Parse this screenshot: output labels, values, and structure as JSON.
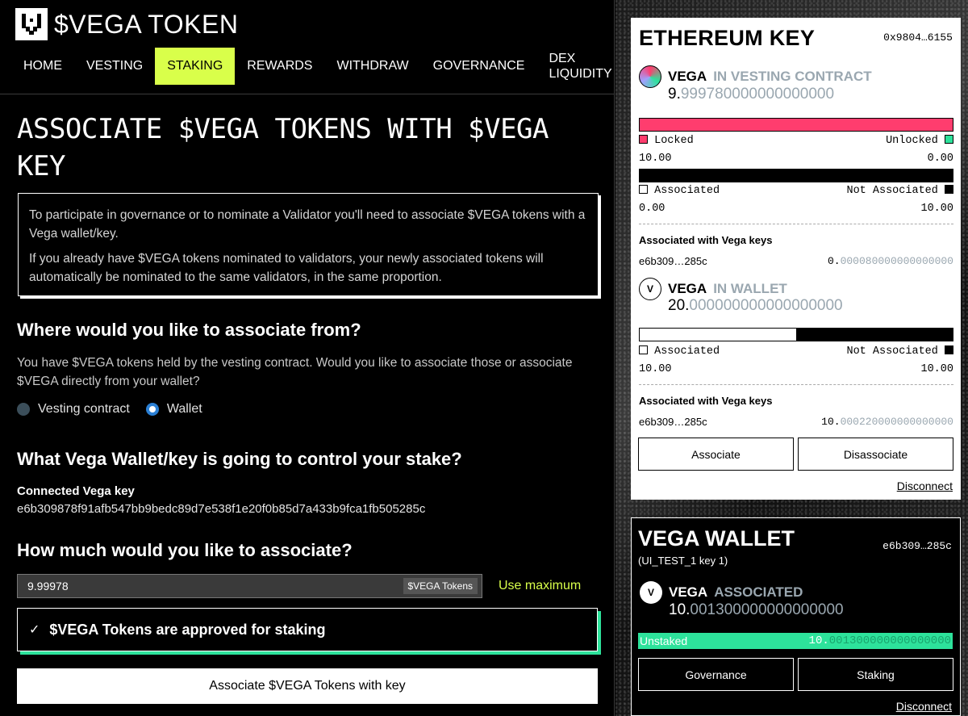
{
  "brand": {
    "title": "$VEGA TOKEN"
  },
  "nav": {
    "items": [
      {
        "label": "HOME"
      },
      {
        "label": "VESTING"
      },
      {
        "label": "STAKING"
      },
      {
        "label": "REWARDS"
      },
      {
        "label": "WITHDRAW"
      },
      {
        "label": "GOVERNANCE"
      },
      {
        "label_line1": "DEX",
        "label_line2": "LIQUIDITY"
      }
    ],
    "active": "STAKING"
  },
  "main": {
    "title": "ASSOCIATE $VEGA TOKENS WITH $VEGA KEY",
    "info_p1": "To participate in governance or to nominate a Validator you'll need to associate $VEGA tokens with a Vega wallet/key.",
    "info_p2": "If you already have $VEGA tokens nominated to validators, your newly associated tokens will automatically be nominated to the same validators, in the same proportion.",
    "from_heading": "Where would you like to associate from?",
    "from_text": "You have $VEGA tokens held by the vesting contract. Would you like to associate those or associate $VEGA directly from your wallet?",
    "radio_vesting": "Vesting contract",
    "radio_wallet": "Wallet",
    "selected_source": "Wallet",
    "wallet_heading": "What Vega Wallet/key is going to control your stake?",
    "connected_key_label": "Connected Vega key",
    "connected_key": "e6b309878f91afb547bb9bedc89d7e538f1e20f0b85d7a433b9fca1fb505285c",
    "amount_heading": "How much would you like to associate?",
    "amount_value": "9.99978",
    "amount_suffix": "$VEGA Tokens",
    "use_max": "Use maximum",
    "approved_text": "$VEGA Tokens are approved for staking",
    "associate_button": "Associate $VEGA Tokens with key"
  },
  "eth": {
    "title": "ETHEREUM KEY",
    "address": "0x9804…6155",
    "vesting": {
      "name": "VEGA",
      "label": "IN VESTING CONTRACT",
      "amount_int": "9.",
      "amount_dec": "999780000000000000",
      "locked_label": "Locked",
      "unlocked_label": "Unlocked",
      "locked_value": "10.00",
      "unlocked_value": "0.00",
      "associated_label": "Associated",
      "not_associated_label": "Not Associated",
      "associated_value": "0.00",
      "not_associated_value": "10.00",
      "keys_heading": "Associated with Vega keys",
      "key": "e6b309…285c",
      "key_amount_int": "0.",
      "key_amount_dec": "000080000000000000",
      "locked_fraction": 1.0,
      "associated_fraction": 0.0
    },
    "wallet": {
      "name": "VEGA",
      "label": "IN WALLET",
      "amount_int": "20.",
      "amount_dec": "000000000000000000",
      "associated_label": "Associated",
      "not_associated_label": "Not Associated",
      "associated_value": "10.00",
      "not_associated_value": "10.00",
      "keys_heading": "Associated with Vega keys",
      "key": "e6b309…285c",
      "key_amount_int": "10.",
      "key_amount_dec": "000220000000000000",
      "associated_fraction": 0.5
    },
    "associate_button": "Associate",
    "disassociate_button": "Disassociate",
    "disconnect": "Disconnect"
  },
  "vega_wallet": {
    "title": "VEGA WALLET",
    "address": "e6b309…285c",
    "subtitle": "(UI_TEST_1 key 1)",
    "name": "VEGA",
    "label": "ASSOCIATED",
    "amount_int": "10.",
    "amount_dec": "001300000000000000",
    "unstaked_label": "Unstaked",
    "unstaked_int": "10.",
    "unstaked_dec": "001300000000000000",
    "governance_button": "Governance",
    "staking_button": "Staking",
    "disconnect": "Disconnect"
  },
  "colors": {
    "accent": "#d9ff4a",
    "locked": "#ff3d6e",
    "unlocked": "#2de29b",
    "muted": "#9aa7b0"
  },
  "icons": [
    "vega-logo-icon",
    "check-icon",
    "vega-token-icon"
  ]
}
